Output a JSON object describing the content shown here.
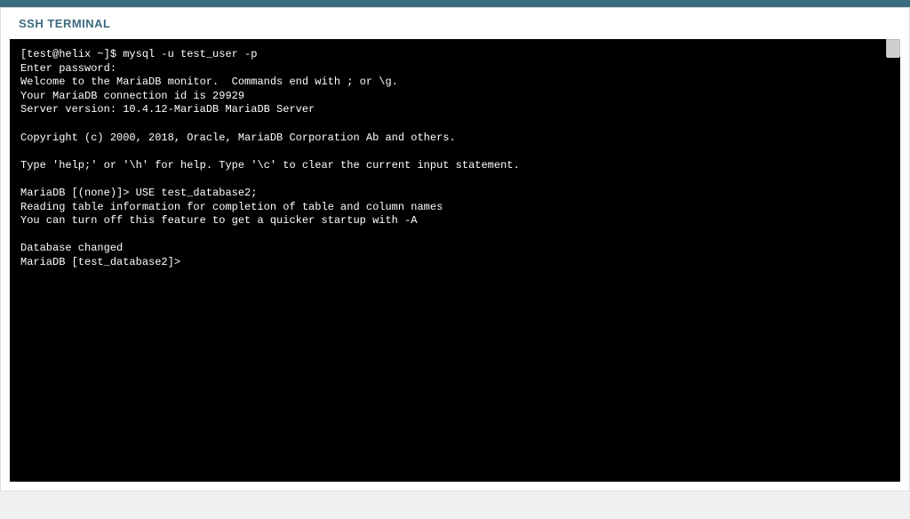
{
  "header": {
    "title": "SSH TERMINAL"
  },
  "terminal": {
    "lines": [
      "[test@helix ~]$ mysql -u test_user -p",
      "Enter password:",
      "Welcome to the MariaDB monitor.  Commands end with ; or \\g.",
      "Your MariaDB connection id is 29929",
      "Server version: 10.4.12-MariaDB MariaDB Server",
      "",
      "Copyright (c) 2000, 2018, Oracle, MariaDB Corporation Ab and others.",
      "",
      "Type 'help;' or '\\h' for help. Type '\\c' to clear the current input statement.",
      "",
      "MariaDB [(none)]> USE test_database2;",
      "Reading table information for completion of table and column names",
      "You can turn off this feature to get a quicker startup with -A",
      "",
      "Database changed",
      "MariaDB [test_database2]>"
    ]
  }
}
